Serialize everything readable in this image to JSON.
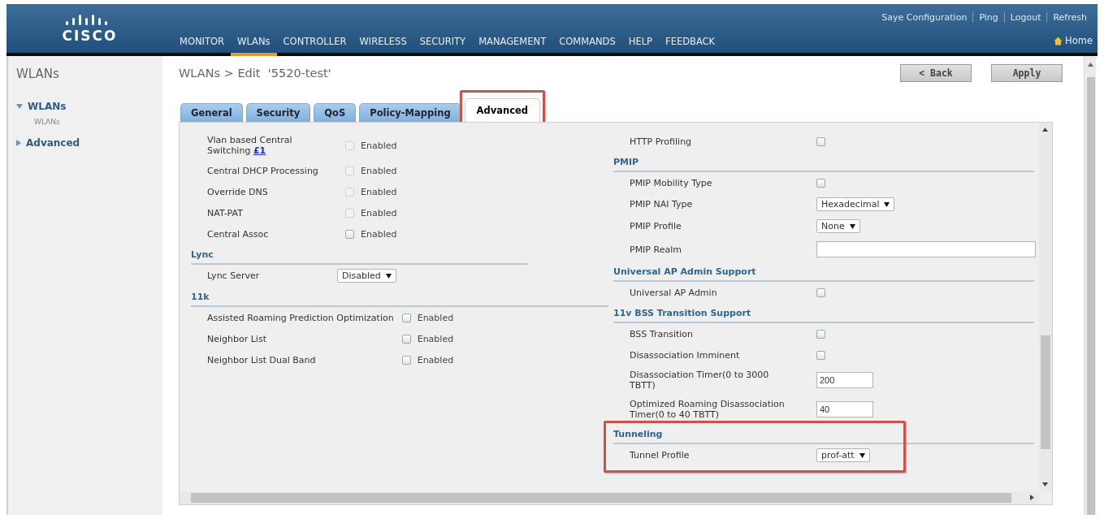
{
  "header": {
    "logo": "CISCO",
    "top_links": [
      "Saye Configuration",
      "Ping",
      "Logout",
      "Refresh"
    ],
    "nav": [
      {
        "label": "MONITOR",
        "selected": false
      },
      {
        "label": "WLANs",
        "selected": true
      },
      {
        "label": "CONTROLLER",
        "selected": false
      },
      {
        "label": "WIRELESS",
        "selected": false
      },
      {
        "label": "SECURITY",
        "selected": false
      },
      {
        "label": "MANAGEMENT",
        "selected": false
      },
      {
        "label": "COMMANDS",
        "selected": false
      },
      {
        "label": "HELP",
        "selected": false
      },
      {
        "label": "FEEDBACK",
        "selected": false
      }
    ],
    "home": "Home"
  },
  "sidebar": {
    "title": "WLANs",
    "items": [
      {
        "label": "WLANs",
        "expanded": true,
        "children": [
          {
            "label": "WLANs"
          }
        ]
      },
      {
        "label": "Advanced",
        "expanded": false
      }
    ]
  },
  "page": {
    "title": "WLANs > Edit  '5520-test'",
    "buttons": [
      "< Back",
      "Apply"
    ]
  },
  "tabs": [
    {
      "label": "General",
      "selected": false,
      "highlighted": false
    },
    {
      "label": "Security",
      "selected": false,
      "highlighted": false
    },
    {
      "label": "QoS",
      "selected": false,
      "highlighted": false
    },
    {
      "label": "Policy-Mapping",
      "selected": false,
      "highlighted": false
    },
    {
      "label": "Advanced",
      "selected": true,
      "highlighted": true
    }
  ],
  "left_column": [
    {
      "highlighted": false,
      "rows": [
        {
          "kind": "checkbox",
          "label": "Vlan based Central Switching",
          "link": "£1",
          "checked": false,
          "disabled": true,
          "option": "Enabled"
        },
        {
          "kind": "checkbox",
          "label": "Central DHCP Processing",
          "checked": false,
          "disabled": true,
          "option": "Enabled"
        },
        {
          "kind": "checkbox",
          "label": "Override DNS",
          "checked": false,
          "disabled": true,
          "option": "Enabled"
        },
        {
          "kind": "checkbox",
          "label": "NAT-PAT",
          "checked": false,
          "disabled": true,
          "option": "Enabled"
        },
        {
          "kind": "checkbox",
          "label": "Central Assoc",
          "checked": false,
          "disabled": false,
          "option": "Enabled"
        }
      ]
    },
    {
      "heading": "Lync",
      "highlighted": false,
      "rows": [
        {
          "kind": "select",
          "label": "Lync Server",
          "value": "Disabled"
        }
      ]
    },
    {
      "heading": "11k",
      "highlighted": false,
      "rows": [
        {
          "kind": "checkbox",
          "label": "Assisted Roaming Prediction Optimization",
          "checked": false,
          "disabled": false,
          "option": "Enabled"
        },
        {
          "kind": "checkbox",
          "label": "Neighbor List",
          "checked": false,
          "disabled": false,
          "option": "Enabled"
        },
        {
          "kind": "checkbox",
          "label": "Neighbor List Dual Band",
          "checked": false,
          "disabled": false,
          "option": "Enabled"
        }
      ]
    }
  ],
  "right_column": [
    {
      "highlighted": false,
      "rows": [
        {
          "kind": "checkbox",
          "label": "HTTP Profiling",
          "checked": false,
          "disabled": false
        }
      ]
    },
    {
      "heading": "PMIP",
      "highlighted": false,
      "rows": [
        {
          "kind": "checkbox",
          "label": "PMIP Mobility Type",
          "checked": false,
          "disabled": false
        },
        {
          "kind": "select",
          "label": "PMIP NAI Type",
          "value": "Hexadecimal"
        },
        {
          "kind": "select",
          "label": "PMIP Profile",
          "value": "None"
        },
        {
          "kind": "text",
          "label": "PMIP Realm"
        }
      ]
    },
    {
      "heading": "Universal AP Admin Support",
      "highlighted": false,
      "rows": [
        {
          "kind": "checkbox",
          "label": "Universal AP Admin",
          "checked": false,
          "disabled": false
        }
      ]
    },
    {
      "heading": "11v BSS Transition Support",
      "highlighted": false,
      "rows": [
        {
          "kind": "checkbox",
          "label": "BSS Transition",
          "checked": false,
          "disabled": false
        },
        {
          "kind": "checkbox",
          "label": "Disassociation Imminent",
          "checked": false,
          "disabled": false
        },
        {
          "kind": "text",
          "label": "Disassociation Timer(0 to 3000 TBTT)",
          "value": "200"
        },
        {
          "kind": "text",
          "label": "Optimized Roaming Disassociation Timer(0 to 40 TBTT)",
          "value": "40"
        }
      ]
    },
    {
      "heading": "Tunneling",
      "highlighted": true,
      "rows": [
        {
          "kind": "select",
          "label": "Tunnel Profile",
          "value": "prof-att"
        }
      ]
    }
  ]
}
